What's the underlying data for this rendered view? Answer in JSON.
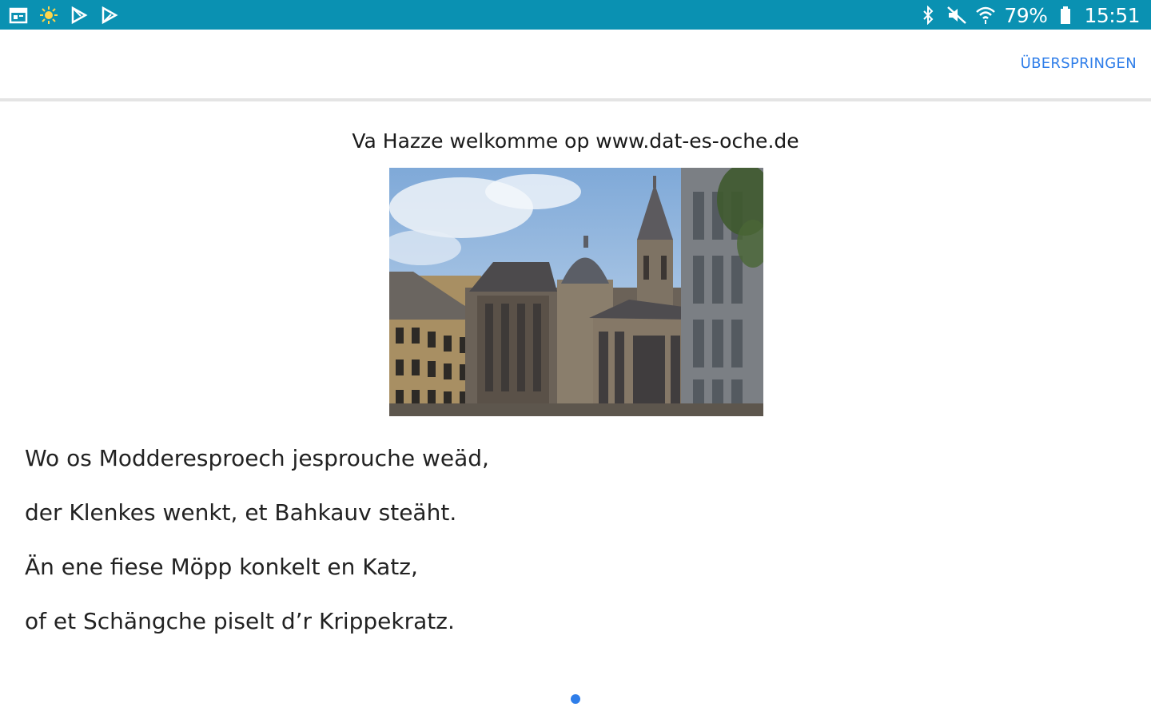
{
  "status_bar": {
    "left_icons": [
      "calendar-icon",
      "brightness-icon",
      "play-store-icon",
      "play-store-icon"
    ],
    "right_icons": [
      "bluetooth-icon",
      "mute-icon",
      "wifi-icon",
      "battery-icon"
    ],
    "battery_percent": "79%",
    "time": "15:51",
    "background": "#0a91b2"
  },
  "appbar": {
    "skip_label": "ÜBERSPRINGEN",
    "accent": "#2f7ee9"
  },
  "content": {
    "heading": "Va Hazze welkomme op www.dat-es-oche.de",
    "image_subject": "cathedral-photo",
    "poem": [
      "Wo os Modderesproech jesprouche weäd,",
      "der Klenkes wenkt, et Bahkauv steäht.",
      "Än ene fiese Möpp konkelt en Katz,",
      "of et Schängche piselt d’r Krippekratz."
    ]
  },
  "pager": {
    "current_page": 1,
    "total_pages": 1
  }
}
